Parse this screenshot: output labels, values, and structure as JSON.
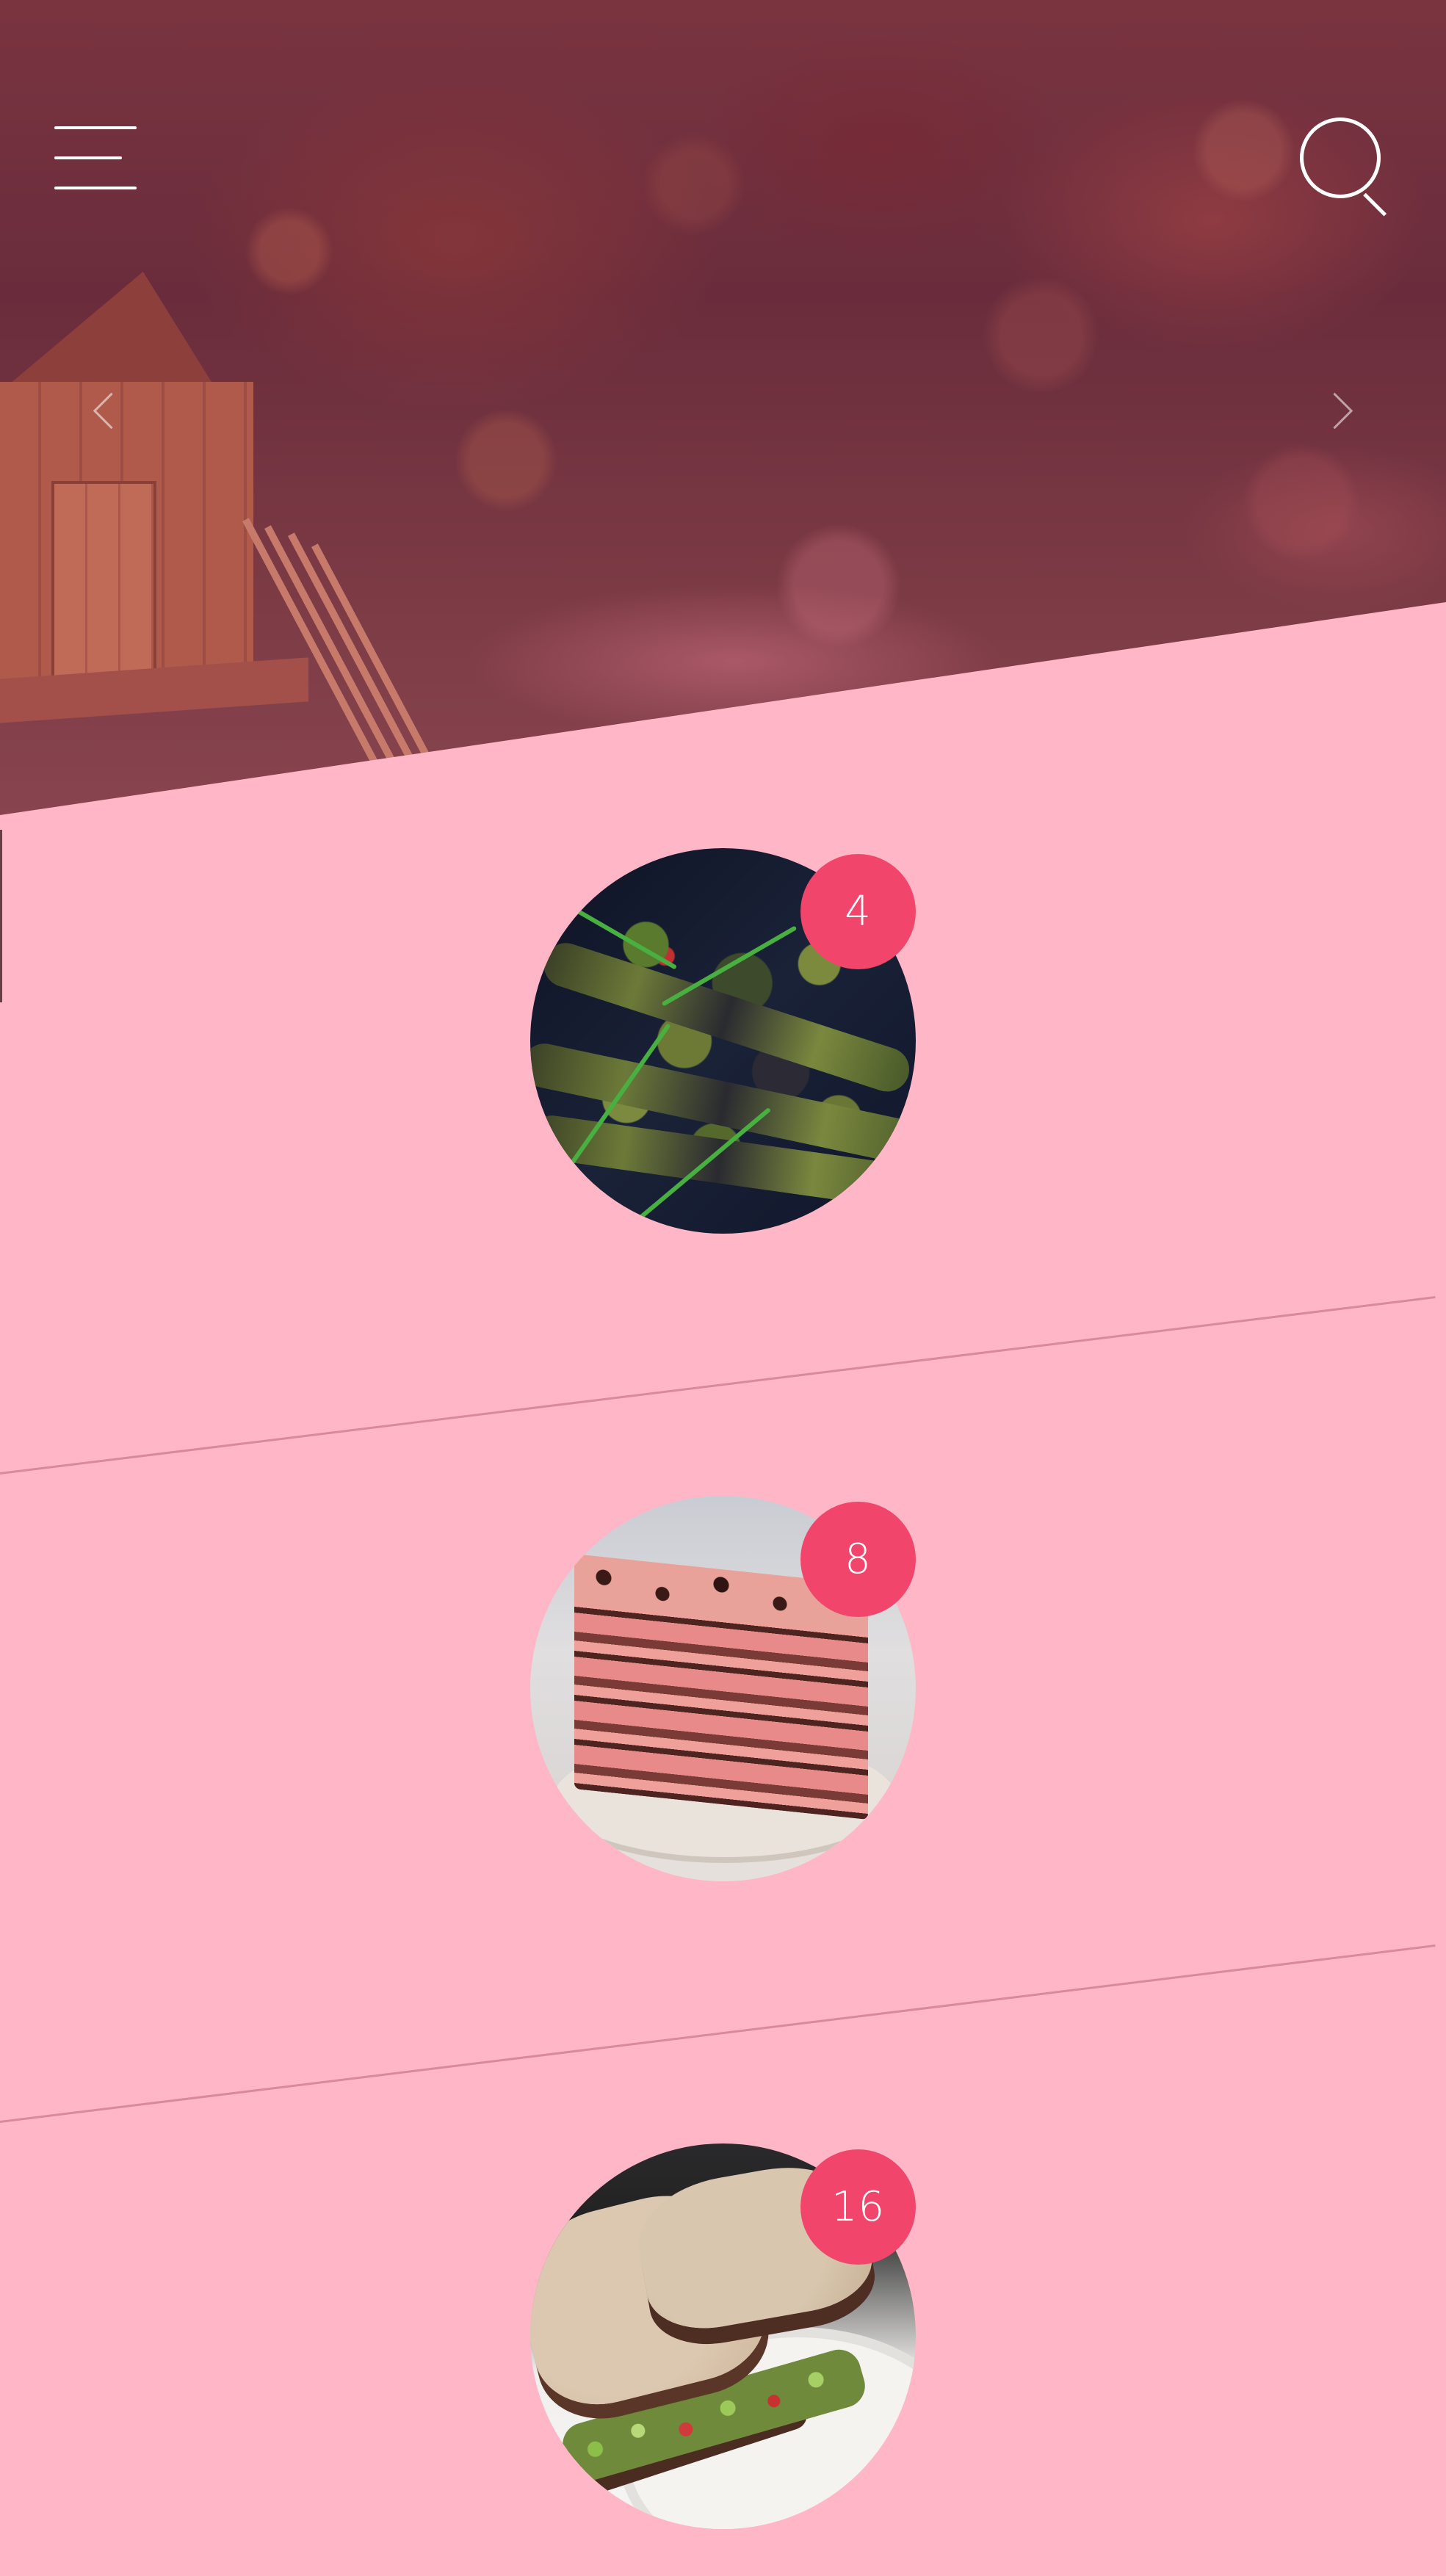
{
  "header": {
    "menu_icon": "hamburger-menu-icon",
    "search_icon": "search-icon",
    "prev_icon": "chevron-left-icon",
    "next_icon": "chevron-right-icon"
  },
  "items": [
    {
      "name": "kebabs",
      "count": "4"
    },
    {
      "name": "cake",
      "count": "8"
    },
    {
      "name": "sandwich",
      "count": "16"
    }
  ],
  "colors": {
    "background": "#ffb6c6",
    "badge": "#f2456c",
    "hero_tint": "#7a3440",
    "divider": "#d88a9c"
  }
}
